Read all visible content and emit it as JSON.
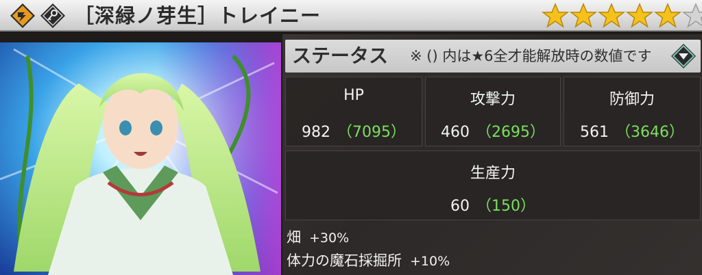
{
  "header": {
    "title": "［深緑ノ芽生］トレイニー",
    "attribute_icon": "fire-attribute-icon",
    "type_icon": "key-type-icon"
  },
  "rarity": {
    "max_stars": 6,
    "filled_stars": 5,
    "star_color": "#f5c21c"
  },
  "status": {
    "title": "ステータス",
    "note": "※ () 内は★6全才能解放時の数値です",
    "dropdown_icon": "chevron-down-icon",
    "stats": [
      {
        "label": "HP",
        "base": "982",
        "max": "（7095）"
      },
      {
        "label": "攻撃力",
        "base": "460",
        "max": "（2695）"
      },
      {
        "label": "防御力",
        "base": "561",
        "max": "（3646）"
      },
      {
        "label": "生産力",
        "base": "60",
        "max": "（150）"
      }
    ]
  },
  "bonuses": [
    {
      "label": "畑",
      "value": "+30%"
    },
    {
      "label": "体力の魔石採掘所",
      "value": "+10%"
    }
  ],
  "colors": {
    "max_value": "#7be05e",
    "header_bg": "#dcdcdc",
    "hair": "#b8e68a"
  }
}
